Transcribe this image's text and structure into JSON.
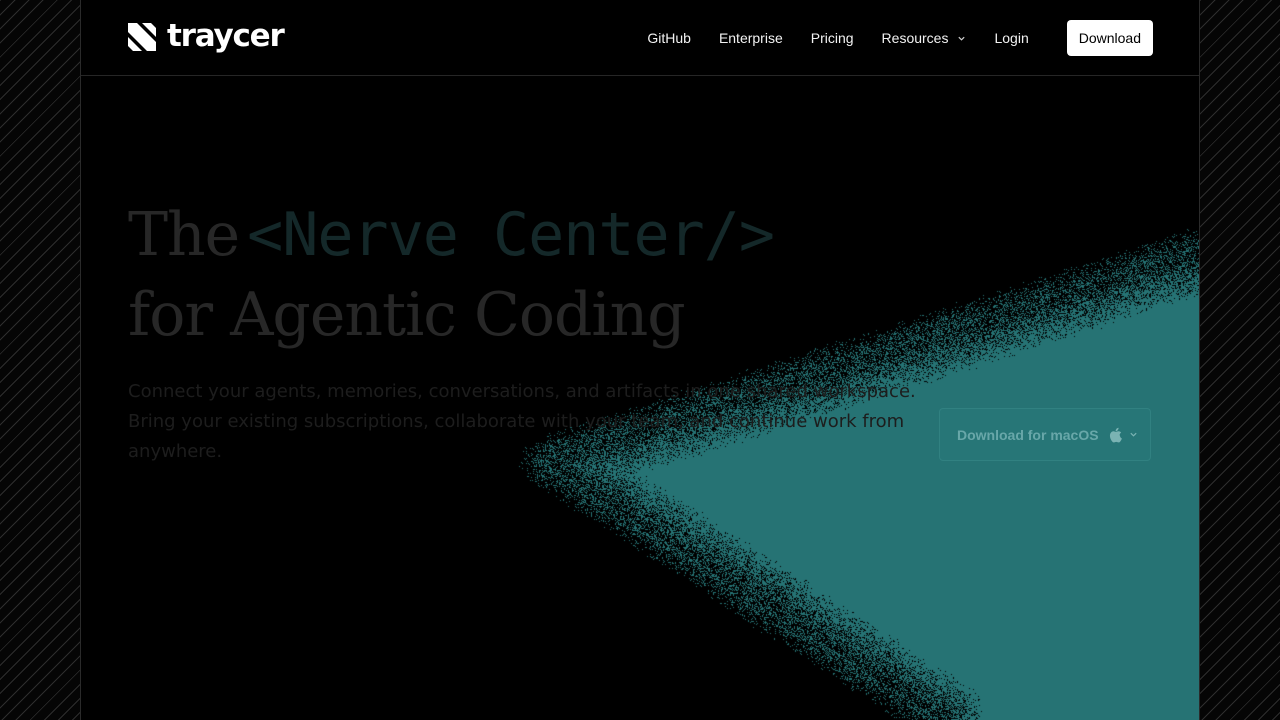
{
  "brand": {
    "name": "traycer",
    "icon": "traycer-logo-icon"
  },
  "nav": {
    "links": [
      {
        "label": "GitHub"
      },
      {
        "label": "Enterprise"
      },
      {
        "label": "Pricing"
      },
      {
        "label": "Resources",
        "icon": "chevron-down-icon"
      },
      {
        "label": "Login"
      }
    ],
    "download_label": "Download"
  },
  "hero": {
    "headline_prefix": "The",
    "headline_code": "<Nerve Center/>",
    "headline_line2": "for Agentic Coding",
    "subtext": "Connect your agents, memories, conversations, and artifacts in one shared workspace. Bring your existing subscriptions, collaborate with your team, and continue work from anywhere.",
    "cta_label": "Download for macOS",
    "cta_icons": [
      "apple-icon",
      "chevron-down-icon"
    ]
  },
  "colors": {
    "background": "#000000",
    "accent_teal": "#267374",
    "download_button": "#ffffff",
    "headline_text": "#272727"
  }
}
